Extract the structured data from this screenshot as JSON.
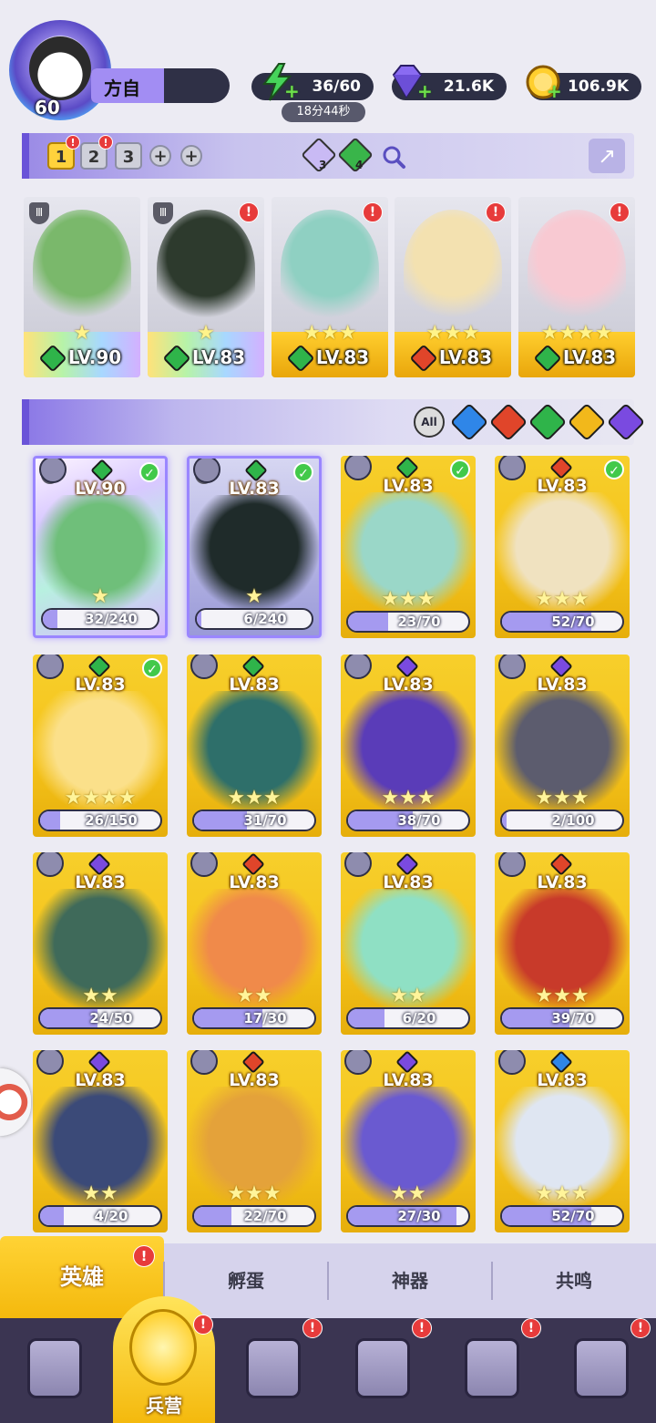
{
  "player": {
    "level": "60",
    "name": "方自"
  },
  "resources": {
    "energy": {
      "value": "36/60",
      "timer": "18分44秒",
      "icon": "lightning-icon"
    },
    "gems": {
      "value": "21.6K",
      "icon": "diamond-icon"
    },
    "gold": {
      "value": "106.9K",
      "icon": "coin-icon"
    }
  },
  "team_tabs": [
    {
      "label": "1",
      "active": true,
      "alert": "!"
    },
    {
      "label": "2",
      "active": false,
      "alert": "!"
    },
    {
      "label": "3",
      "active": false,
      "alert": ""
    },
    {
      "label": "+",
      "active": false,
      "alert": ""
    },
    {
      "label": "+",
      "active": false,
      "alert": ""
    }
  ],
  "team_gems": [
    {
      "count": "3",
      "color": "#b9a7f0"
    },
    {
      "count": "4",
      "color": "#39b54a"
    }
  ],
  "team_cards": [
    {
      "lv": "LV.90",
      "stars": "★",
      "element": "nature",
      "elem_color": "#2fb44a",
      "style": "rainbow",
      "shield": "Ⅲ",
      "alert": false
    },
    {
      "lv": "LV.83",
      "stars": "★",
      "element": "nature",
      "elem_color": "#2fb44a",
      "style": "rainbow",
      "shield": "Ⅲ",
      "alert": true
    },
    {
      "lv": "LV.83",
      "stars": "★★★",
      "element": "nature",
      "elem_color": "#2fb44a",
      "style": "gold",
      "shield": "",
      "alert": true
    },
    {
      "lv": "LV.83",
      "stars": "★★★",
      "element": "fire",
      "elem_color": "#e0452a",
      "style": "gold",
      "shield": "",
      "alert": true
    },
    {
      "lv": "LV.83",
      "stars": "★★★★",
      "element": "nature",
      "elem_color": "#2fb44a",
      "style": "gold",
      "shield": "",
      "alert": true
    }
  ],
  "filters": {
    "all_label": "All",
    "elements": [
      {
        "name": "water",
        "color": "#2f86e8"
      },
      {
        "name": "fire",
        "color": "#e0452a"
      },
      {
        "name": "nature",
        "color": "#2fb44a"
      },
      {
        "name": "light",
        "color": "#f2b81b"
      },
      {
        "name": "dark",
        "color": "#7a4ae0"
      }
    ]
  },
  "heroes": [
    {
      "lv": "LV.90",
      "shards": "32/240",
      "progress": 0.13,
      "element_color": "#2fb44a",
      "checked": true,
      "style": "rainbow",
      "shield": "Ⅲ",
      "stars": "★",
      "art": "#6fbf7a"
    },
    {
      "lv": "LV.83",
      "shards": "6/240",
      "progress": 0.03,
      "element_color": "#2fb44a",
      "checked": true,
      "style": "dark",
      "shield": "Ⅲ",
      "stars": "★",
      "art": "#1f2b2a"
    },
    {
      "lv": "LV.83",
      "shards": "23/70",
      "progress": 0.33,
      "element_color": "#2fb44a",
      "checked": true,
      "style": "gold",
      "shield": "",
      "stars": "★★★",
      "art": "#9ad7c8"
    },
    {
      "lv": "LV.83",
      "shards": "52/70",
      "progress": 0.74,
      "element_color": "#e0452a",
      "checked": true,
      "style": "gold",
      "shield": "",
      "stars": "★★★",
      "art": "#f0e2c0"
    },
    {
      "lv": "LV.83",
      "shards": "26/150",
      "progress": 0.17,
      "element_color": "#2fb44a",
      "checked": true,
      "style": "gold",
      "shield": "",
      "stars": "★★★★",
      "art": "#fbe08a"
    },
    {
      "lv": "LV.83",
      "shards": "31/70",
      "progress": 0.44,
      "element_color": "#2fb44a",
      "checked": false,
      "style": "gold",
      "shield": "",
      "stars": "★★★",
      "art": "#2e6f6a"
    },
    {
      "lv": "LV.83",
      "shards": "38/70",
      "progress": 0.54,
      "element_color": "#7a4ae0",
      "checked": false,
      "style": "gold",
      "shield": "",
      "stars": "★★★",
      "art": "#5a3cb8"
    },
    {
      "lv": "LV.83",
      "shards": "2/100",
      "progress": 0.02,
      "element_color": "#7a4ae0",
      "checked": false,
      "style": "gold",
      "shield": "",
      "stars": "★★★",
      "art": "#5c5c6e"
    },
    {
      "lv": "LV.83",
      "shards": "24/50",
      "progress": 0.48,
      "element_color": "#7a4ae0",
      "checked": false,
      "style": "gold",
      "shield": "",
      "stars": "★★",
      "art": "#3f6a5a"
    },
    {
      "lv": "LV.83",
      "shards": "17/30",
      "progress": 0.57,
      "element_color": "#e0452a",
      "checked": false,
      "style": "gold",
      "shield": "",
      "stars": "★★",
      "art": "#f08a4a"
    },
    {
      "lv": "LV.83",
      "shards": "6/20",
      "progress": 0.3,
      "element_color": "#7a4ae0",
      "checked": false,
      "style": "gold",
      "shield": "",
      "stars": "★★",
      "art": "#8fe0c4"
    },
    {
      "lv": "LV.83",
      "shards": "39/70",
      "progress": 0.56,
      "element_color": "#e0452a",
      "checked": false,
      "style": "gold",
      "shield": "",
      "stars": "★★★",
      "art": "#c83a2a"
    },
    {
      "lv": "LV.83",
      "shards": "4/20",
      "progress": 0.2,
      "element_color": "#7a4ae0",
      "checked": false,
      "style": "gold",
      "shield": "",
      "stars": "★★",
      "art": "#3b4a78"
    },
    {
      "lv": "LV.83",
      "shards": "22/70",
      "progress": 0.31,
      "element_color": "#e0452a",
      "checked": false,
      "style": "gold",
      "shield": "",
      "stars": "★★★",
      "art": "#e4a23a"
    },
    {
      "lv": "LV.83",
      "shards": "27/30",
      "progress": 0.9,
      "element_color": "#7a4ae0",
      "checked": false,
      "style": "gold",
      "shield": "",
      "stars": "★★",
      "art": "#6a5ad0"
    },
    {
      "lv": "LV.83",
      "shards": "52/70",
      "progress": 0.74,
      "element_color": "#2f86e8",
      "checked": false,
      "style": "gold",
      "shield": "",
      "stars": "★★★",
      "art": "#dfe6f2"
    }
  ],
  "sub_tabs": [
    {
      "label": "英雄",
      "active": true,
      "alert": true
    },
    {
      "label": "孵蛋",
      "active": false,
      "alert": false
    },
    {
      "label": "神器",
      "active": false,
      "alert": false
    },
    {
      "label": "共鸣",
      "active": false,
      "alert": false
    }
  ],
  "nav": [
    {
      "name": "cards",
      "label": "",
      "active": false,
      "alert": false
    },
    {
      "name": "barracks",
      "label": "兵营",
      "active": true,
      "alert": true
    },
    {
      "name": "book",
      "label": "",
      "active": false,
      "alert": true
    },
    {
      "name": "castle",
      "label": "",
      "active": false,
      "alert": true
    },
    {
      "name": "mushroom",
      "label": "",
      "active": false,
      "alert": true
    },
    {
      "name": "guild",
      "label": "",
      "active": false,
      "alert": true
    }
  ]
}
